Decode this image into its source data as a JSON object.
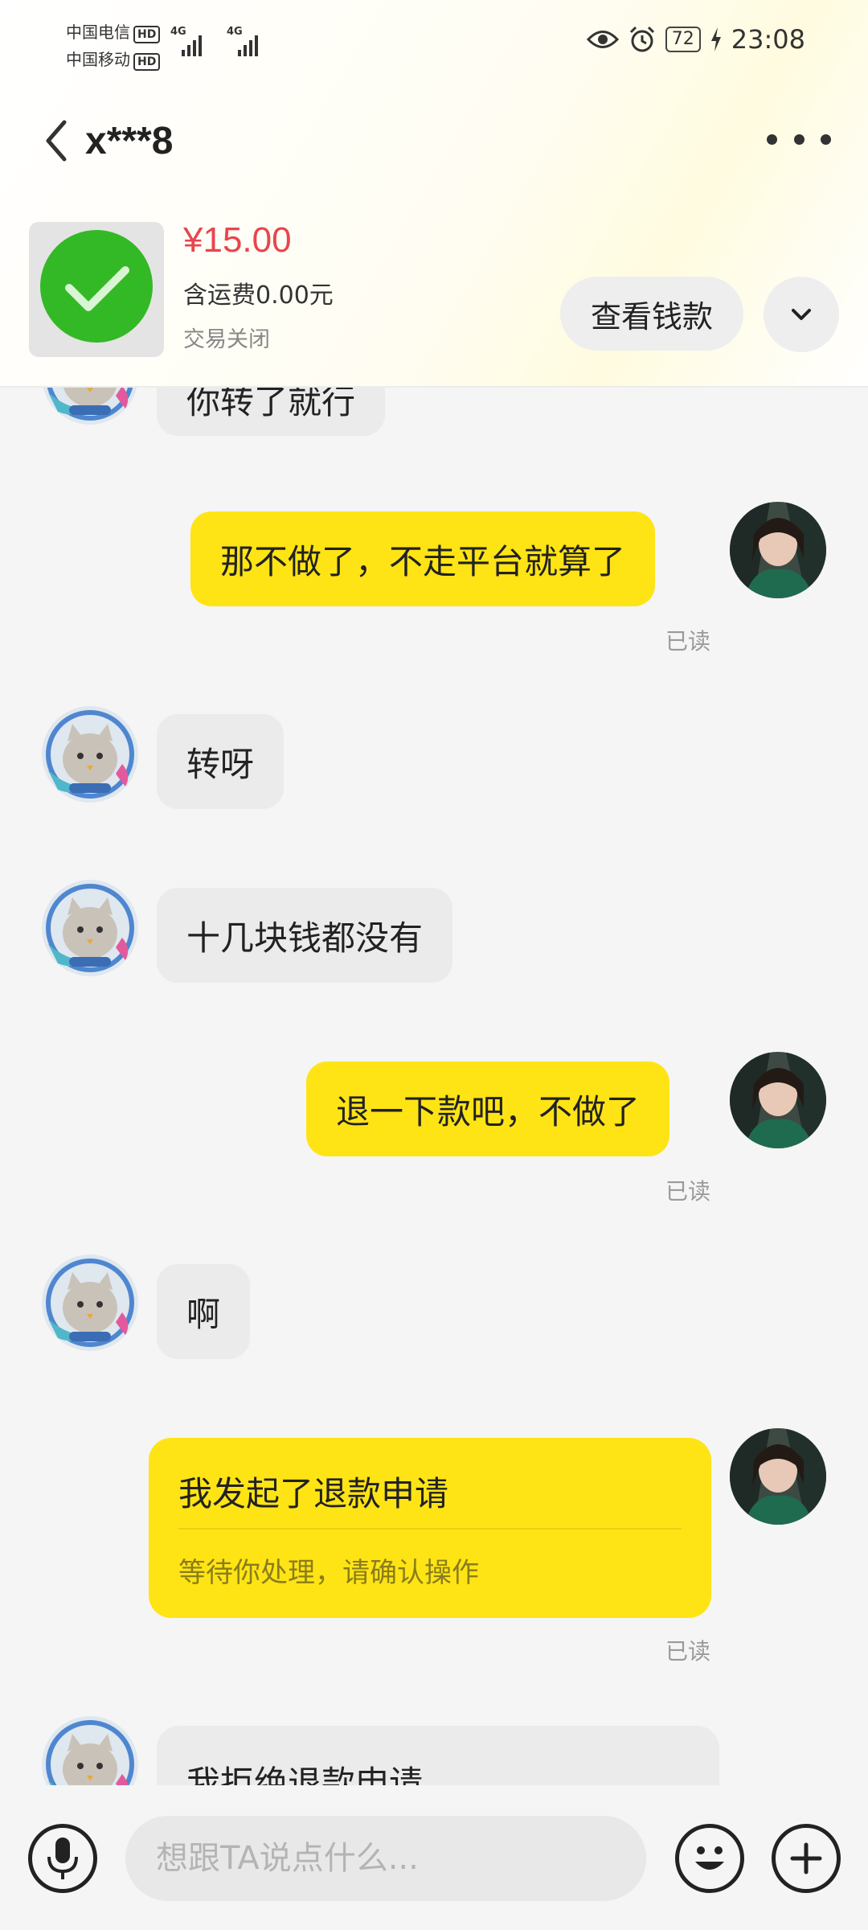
{
  "status_bar": {
    "carrier1": "中国电信",
    "carrier2": "中国移动",
    "hd": "HD",
    "network1": "4G",
    "network2": "4G",
    "battery": "72",
    "time": "23:08"
  },
  "header": {
    "contact_name": "x***8"
  },
  "order": {
    "price": "¥15.00",
    "shipping": "含运费0.00元",
    "status": "交易关闭",
    "view_button": "查看钱款"
  },
  "messages": [
    {
      "side": "left",
      "text": "你转了就行"
    },
    {
      "side": "right",
      "text": "那不做了，不走平台就算了",
      "read": "已读"
    },
    {
      "side": "left",
      "text": "转呀"
    },
    {
      "side": "left",
      "text": "十几块钱都没有"
    },
    {
      "side": "right",
      "text": "退一下款吧，不做了",
      "read": "已读"
    },
    {
      "side": "left",
      "text": "啊"
    },
    {
      "side": "right",
      "type": "card",
      "title": "我发起了退款申请",
      "subtitle": "等待你处理，请确认操作",
      "read": "已读"
    },
    {
      "side": "left",
      "type": "card",
      "title": "我拒绝退款申请"
    }
  ],
  "input": {
    "placeholder": "想跟TA说点什么..."
  },
  "colors": {
    "bubble_self": "#ffe415",
    "bubble_other": "#ebebeb",
    "price": "#e8454c",
    "check_green": "#34b926"
  }
}
